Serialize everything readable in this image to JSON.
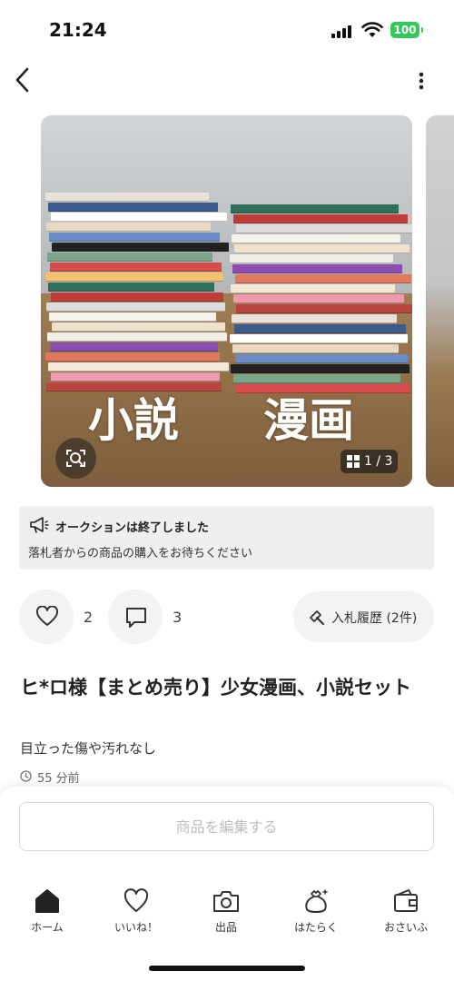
{
  "status_bar": {
    "time": "21:24",
    "battery": "100"
  },
  "photo": {
    "caption_left": "小説",
    "caption_right": "漫画",
    "counter": "1 / 3"
  },
  "notice": {
    "title": "オークションは終了しました",
    "message": "落札者からの商品の購入をお待ちください"
  },
  "actions": {
    "likes": "2",
    "comments": "3",
    "bid_history": "入札履歴 (2件)"
  },
  "item": {
    "title": "ヒ*ロ様【まとめ売り】少女漫画、小説セット",
    "condition": "目立った傷や汚れなし",
    "posted": "55 分前"
  },
  "edit_button": "商品を編集する",
  "tabs": [
    {
      "label": "ホーム",
      "icon": "home-icon"
    },
    {
      "label": "いいね！",
      "icon": "heart-icon"
    },
    {
      "label": "出品",
      "icon": "camera-icon"
    },
    {
      "label": "はたらく",
      "icon": "money-bag-icon"
    },
    {
      "label": "おさいふ",
      "icon": "wallet-icon"
    }
  ],
  "colors": {
    "battery": "#34c759",
    "text": "#222222",
    "notice_bg": "#efefef",
    "disabled_text": "#bdbdbd"
  }
}
